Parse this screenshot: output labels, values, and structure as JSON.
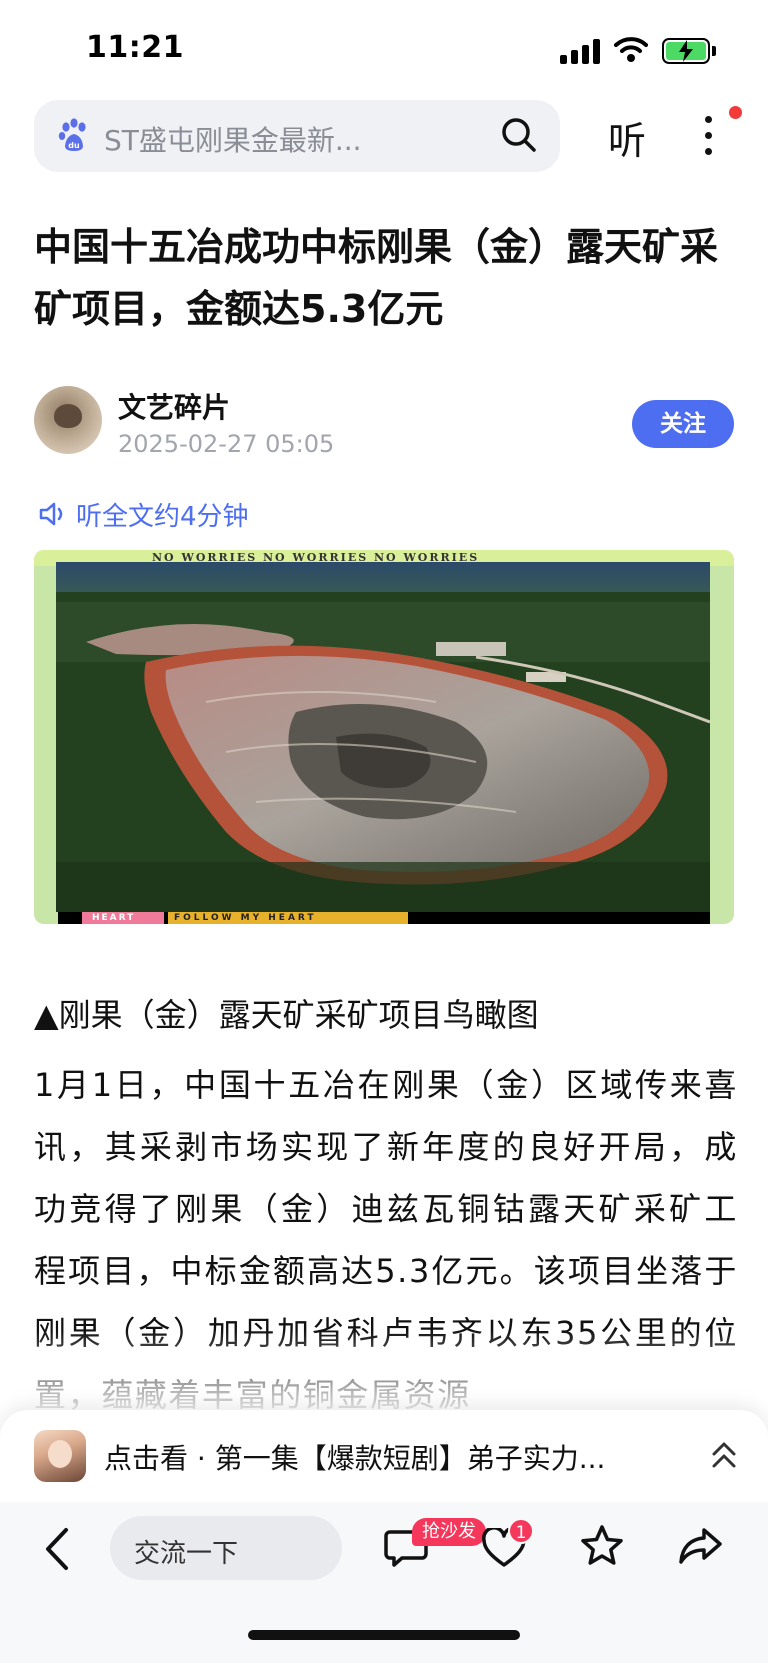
{
  "status_bar": {
    "time": "11:21"
  },
  "search": {
    "query": "ST盛屯刚果金最新..."
  },
  "header": {
    "listen_label": "听"
  },
  "article": {
    "title": "中国十五冶成功中标刚果（金）露天矿采矿项目，金额达5.3亿元",
    "author": "文艺碎片",
    "time": "2025-02-27 05:05",
    "follow_label": "关注",
    "listen_full": "听全文约4分钟",
    "image_overlay": {
      "top_band": "NO WORRIES NO WORRIES NO WORRIES",
      "bottom_pink": "HEART",
      "bottom_band": "FOLLOW MY HEART"
    },
    "caption": "▲刚果（金）露天矿采矿项目鸟瞰图",
    "paragraph": "1月1日，中国十五冶在刚果（金）区域传来喜讯，其采剥市场实现了新年度的良好开局，成功竞得了刚果（金）迪兹瓦铜钴露天矿采矿工程项目，中标金额高达5.3亿元。该项目坐落于刚果（金）加丹加省科卢韦齐以东35公里的位置，蕴藏着丰富的铜金属资源"
  },
  "drama_banner": {
    "title": "点击看 · 第一集【爆款短剧】弟子实力..."
  },
  "bottom_bar": {
    "comment_placeholder": "交流一下",
    "sofa_badge": "抢沙发",
    "like_count": "1"
  },
  "colors": {
    "accent": "#4e6ef2",
    "badge_red": "#f5375b",
    "battery_green": "#4cd964"
  },
  "icons": [
    "paw-icon",
    "search-icon",
    "more-icon",
    "speaker-icon",
    "back-icon",
    "comment-icon",
    "heart-icon",
    "star-icon",
    "share-icon",
    "chevron-up-icon"
  ]
}
